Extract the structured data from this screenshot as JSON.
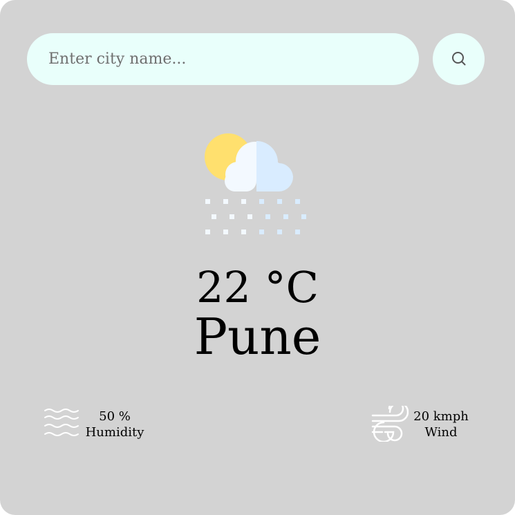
{
  "search": {
    "placeholder": "Enter city name...",
    "value": "",
    "button_icon": "search-icon"
  },
  "weather": {
    "icon": "snow-cloud-sun-icon",
    "temperature": "22 °C",
    "city": "Pune"
  },
  "details": {
    "humidity": {
      "icon": "humidity-waves-icon",
      "value": "50 %",
      "label": "Humidity"
    },
    "wind": {
      "icon": "wind-icon",
      "value": "20 kmph",
      "label": "Wind"
    }
  },
  "colors": {
    "card_background": "#d3d3d3",
    "input_background": "#e9fffb",
    "sun": "#ffe06e",
    "cloud_light": "#f3f9ff",
    "cloud_shade": "#d9ecff",
    "text": "#000000"
  }
}
